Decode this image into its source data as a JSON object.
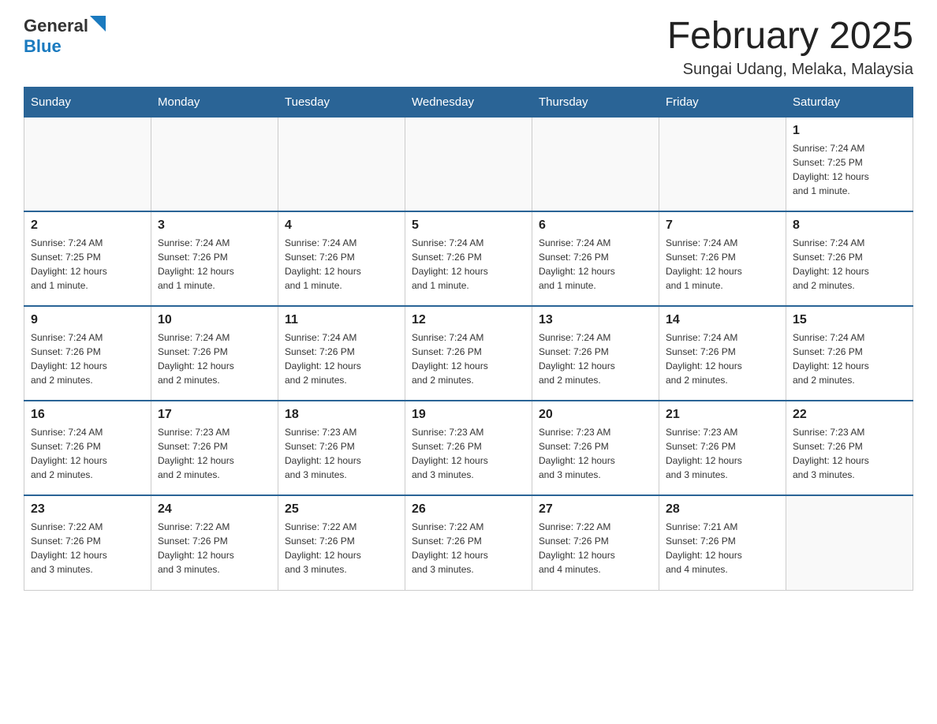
{
  "header": {
    "logo_general": "General",
    "logo_blue": "Blue",
    "month_title": "February 2025",
    "location": "Sungai Udang, Melaka, Malaysia"
  },
  "days_of_week": [
    "Sunday",
    "Monday",
    "Tuesday",
    "Wednesday",
    "Thursday",
    "Friday",
    "Saturday"
  ],
  "weeks": [
    [
      {
        "day": "",
        "info": ""
      },
      {
        "day": "",
        "info": ""
      },
      {
        "day": "",
        "info": ""
      },
      {
        "day": "",
        "info": ""
      },
      {
        "day": "",
        "info": ""
      },
      {
        "day": "",
        "info": ""
      },
      {
        "day": "1",
        "info": "Sunrise: 7:24 AM\nSunset: 7:25 PM\nDaylight: 12 hours\nand 1 minute."
      }
    ],
    [
      {
        "day": "2",
        "info": "Sunrise: 7:24 AM\nSunset: 7:25 PM\nDaylight: 12 hours\nand 1 minute."
      },
      {
        "day": "3",
        "info": "Sunrise: 7:24 AM\nSunset: 7:26 PM\nDaylight: 12 hours\nand 1 minute."
      },
      {
        "day": "4",
        "info": "Sunrise: 7:24 AM\nSunset: 7:26 PM\nDaylight: 12 hours\nand 1 minute."
      },
      {
        "day": "5",
        "info": "Sunrise: 7:24 AM\nSunset: 7:26 PM\nDaylight: 12 hours\nand 1 minute."
      },
      {
        "day": "6",
        "info": "Sunrise: 7:24 AM\nSunset: 7:26 PM\nDaylight: 12 hours\nand 1 minute."
      },
      {
        "day": "7",
        "info": "Sunrise: 7:24 AM\nSunset: 7:26 PM\nDaylight: 12 hours\nand 1 minute."
      },
      {
        "day": "8",
        "info": "Sunrise: 7:24 AM\nSunset: 7:26 PM\nDaylight: 12 hours\nand 2 minutes."
      }
    ],
    [
      {
        "day": "9",
        "info": "Sunrise: 7:24 AM\nSunset: 7:26 PM\nDaylight: 12 hours\nand 2 minutes."
      },
      {
        "day": "10",
        "info": "Sunrise: 7:24 AM\nSunset: 7:26 PM\nDaylight: 12 hours\nand 2 minutes."
      },
      {
        "day": "11",
        "info": "Sunrise: 7:24 AM\nSunset: 7:26 PM\nDaylight: 12 hours\nand 2 minutes."
      },
      {
        "day": "12",
        "info": "Sunrise: 7:24 AM\nSunset: 7:26 PM\nDaylight: 12 hours\nand 2 minutes."
      },
      {
        "day": "13",
        "info": "Sunrise: 7:24 AM\nSunset: 7:26 PM\nDaylight: 12 hours\nand 2 minutes."
      },
      {
        "day": "14",
        "info": "Sunrise: 7:24 AM\nSunset: 7:26 PM\nDaylight: 12 hours\nand 2 minutes."
      },
      {
        "day": "15",
        "info": "Sunrise: 7:24 AM\nSunset: 7:26 PM\nDaylight: 12 hours\nand 2 minutes."
      }
    ],
    [
      {
        "day": "16",
        "info": "Sunrise: 7:24 AM\nSunset: 7:26 PM\nDaylight: 12 hours\nand 2 minutes."
      },
      {
        "day": "17",
        "info": "Sunrise: 7:23 AM\nSunset: 7:26 PM\nDaylight: 12 hours\nand 2 minutes."
      },
      {
        "day": "18",
        "info": "Sunrise: 7:23 AM\nSunset: 7:26 PM\nDaylight: 12 hours\nand 3 minutes."
      },
      {
        "day": "19",
        "info": "Sunrise: 7:23 AM\nSunset: 7:26 PM\nDaylight: 12 hours\nand 3 minutes."
      },
      {
        "day": "20",
        "info": "Sunrise: 7:23 AM\nSunset: 7:26 PM\nDaylight: 12 hours\nand 3 minutes."
      },
      {
        "day": "21",
        "info": "Sunrise: 7:23 AM\nSunset: 7:26 PM\nDaylight: 12 hours\nand 3 minutes."
      },
      {
        "day": "22",
        "info": "Sunrise: 7:23 AM\nSunset: 7:26 PM\nDaylight: 12 hours\nand 3 minutes."
      }
    ],
    [
      {
        "day": "23",
        "info": "Sunrise: 7:22 AM\nSunset: 7:26 PM\nDaylight: 12 hours\nand 3 minutes."
      },
      {
        "day": "24",
        "info": "Sunrise: 7:22 AM\nSunset: 7:26 PM\nDaylight: 12 hours\nand 3 minutes."
      },
      {
        "day": "25",
        "info": "Sunrise: 7:22 AM\nSunset: 7:26 PM\nDaylight: 12 hours\nand 3 minutes."
      },
      {
        "day": "26",
        "info": "Sunrise: 7:22 AM\nSunset: 7:26 PM\nDaylight: 12 hours\nand 3 minutes."
      },
      {
        "day": "27",
        "info": "Sunrise: 7:22 AM\nSunset: 7:26 PM\nDaylight: 12 hours\nand 4 minutes."
      },
      {
        "day": "28",
        "info": "Sunrise: 7:21 AM\nSunset: 7:26 PM\nDaylight: 12 hours\nand 4 minutes."
      },
      {
        "day": "",
        "info": ""
      }
    ]
  ]
}
